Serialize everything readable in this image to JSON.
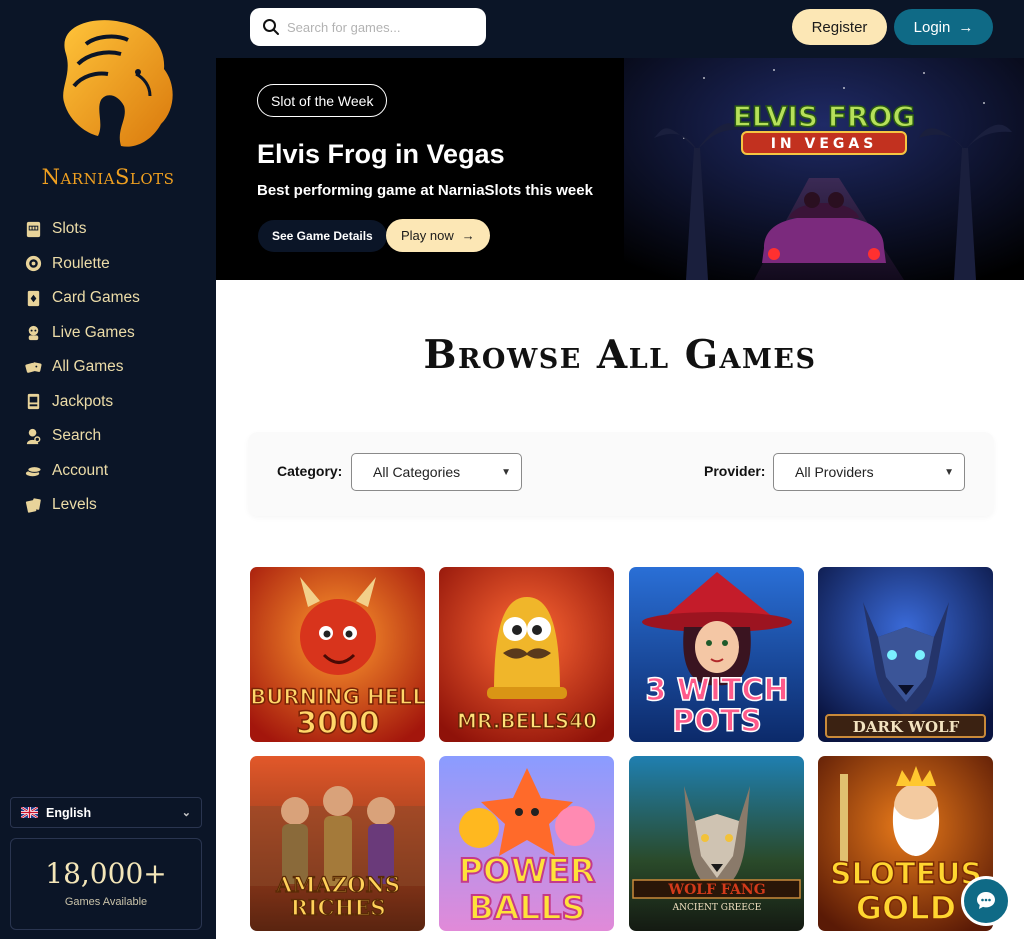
{
  "brand": {
    "logo_text": "NarniaSlots"
  },
  "sidebar": {
    "items": [
      {
        "label": "Slots",
        "icon": "slot-machine-icon"
      },
      {
        "label": "Roulette",
        "icon": "roulette-icon"
      },
      {
        "label": "Card Games",
        "icon": "card-icon"
      },
      {
        "label": "Live Games",
        "icon": "dealer-icon"
      },
      {
        "label": "All Games",
        "icon": "dice-icon"
      },
      {
        "label": "Jackpots",
        "icon": "jackpot-icon"
      },
      {
        "label": "Search",
        "icon": "search-person-icon"
      },
      {
        "label": "Account",
        "icon": "coins-icon"
      },
      {
        "label": "Levels",
        "icon": "levels-icon"
      }
    ],
    "language": "English",
    "games_count": "18,000+",
    "games_count_label": "Games Available"
  },
  "header": {
    "search_placeholder": "Search for games...",
    "register_label": "Register",
    "login_label": "Login"
  },
  "hero": {
    "badge": "Slot of the Week",
    "title": "Elvis Frog in Vegas",
    "subtitle": "Best performing game at NarniaSlots this week",
    "details_label": "See Game Details",
    "play_label": "Play now",
    "art_title": "ELVIS FROG",
    "art_sub": "IN VEGAS"
  },
  "browse": {
    "title": "Browse All Games",
    "category_label": "Category:",
    "category_value": "All Categories",
    "provider_label": "Provider:",
    "provider_value": "All Providers"
  },
  "games": [
    {
      "line1": "BURNING HELL",
      "line2": "3000"
    },
    {
      "line1": "MR.BELLS40",
      "line2": ""
    },
    {
      "line1": "3 WITCH",
      "line2": "POTS"
    },
    {
      "line1": "DARK WOLF",
      "line2": ""
    },
    {
      "line1": "AMAZONS",
      "line2": "RICHES"
    },
    {
      "line1": "POWER",
      "line2": "BALLS"
    },
    {
      "line1": "WOLF FANG",
      "line2": "ANCIENT GREECE"
    },
    {
      "line1": "SLOTEUS",
      "line2": "GOLD"
    }
  ],
  "colors": {
    "sidebar_bg": "#0b1527",
    "accent_cream": "#fce7b5",
    "accent_teal": "#0f6a86",
    "logo_gold": "#f0a020"
  }
}
